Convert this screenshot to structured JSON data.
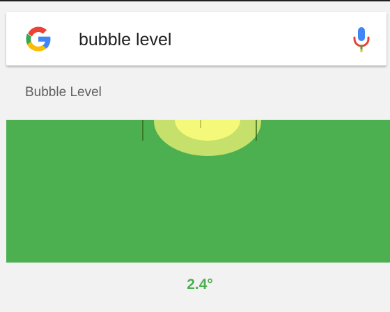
{
  "search": {
    "query": "bubble level"
  },
  "card": {
    "title": "Bubble Level",
    "angle": "2.4°"
  },
  "icons": {
    "logo": "google-g-icon",
    "mic": "microphone-icon"
  },
  "level": {
    "tilt_degrees": 2.4
  },
  "colors": {
    "background": "#f2f2f2",
    "level_green": "#4caf50",
    "bubble_inner": "#f4f97a",
    "bubble_outer": "#c5e06b",
    "angle_text": "#4caf50",
    "google_blue": "#4285f4",
    "google_red": "#ea4335",
    "google_yellow": "#fbbc05",
    "google_green": "#34a853"
  }
}
